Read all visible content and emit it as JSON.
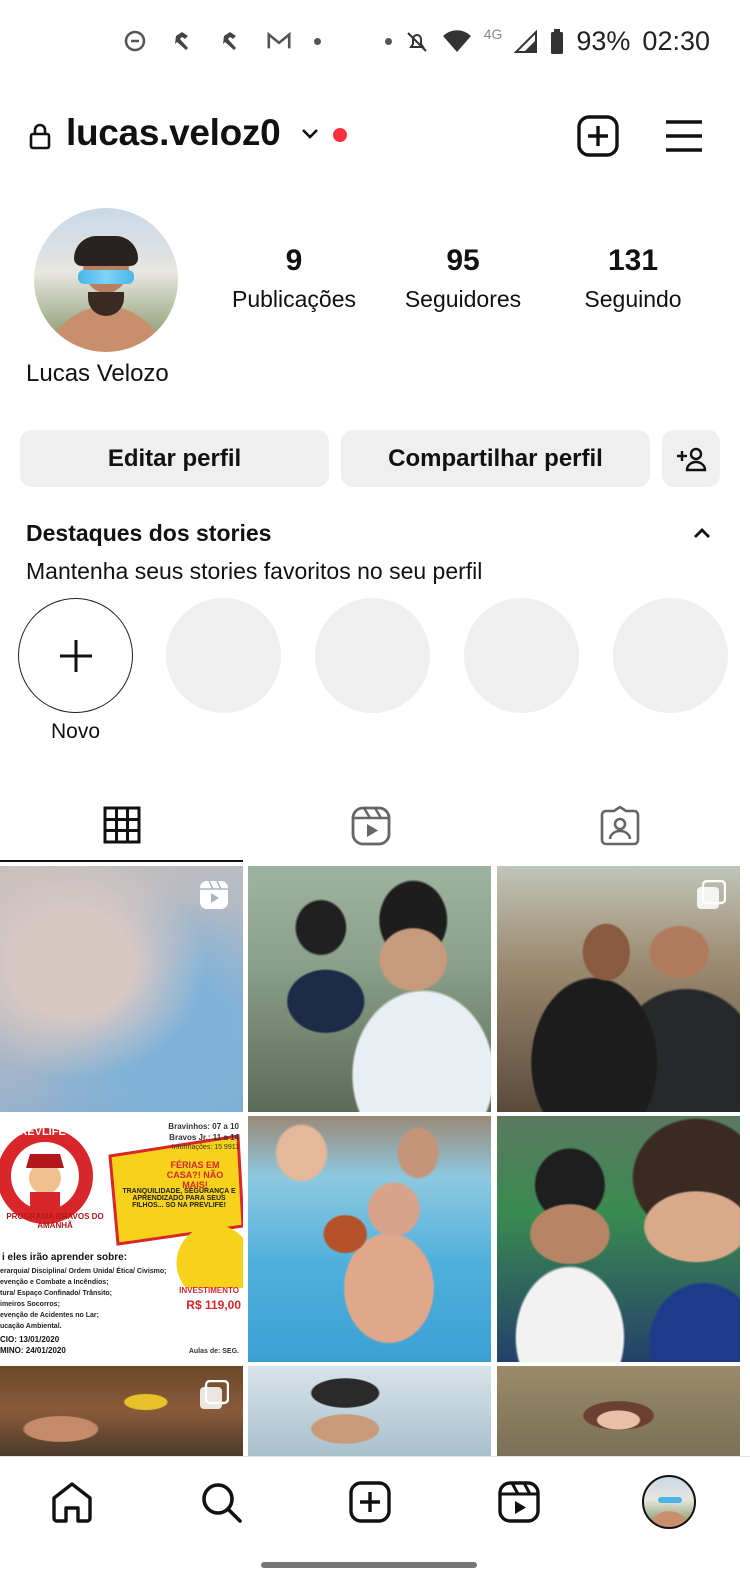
{
  "status_bar": {
    "left_icons": [
      "gmail-icon",
      "hammer-icon",
      "hammer-icon",
      "gmail-m-icon",
      "dot-icon"
    ],
    "network": "4G",
    "battery": "93%",
    "time": "02:30"
  },
  "header": {
    "username": "lucas.veloz0"
  },
  "profile": {
    "full_name": "Lucas Velozo",
    "stats": [
      {
        "value": "9",
        "label": "Publicações"
      },
      {
        "value": "95",
        "label": "Seguidores"
      },
      {
        "value": "131",
        "label": "Seguindo"
      }
    ]
  },
  "actions": {
    "edit_label": "Editar perfil",
    "share_label": "Compartilhar perfil"
  },
  "highlights": {
    "title": "Destaques dos stories",
    "subtitle": "Mantenha seus stories favoritos no seu perfil",
    "new_label": "Novo"
  },
  "tabs": [
    "grid-icon",
    "reels-icon",
    "tagged-icon"
  ],
  "grid": {
    "posts": [
      {
        "kind": "reel",
        "desc": "blurred"
      },
      {
        "kind": "photo",
        "desc": "selfie motorcycle"
      },
      {
        "kind": "carousel",
        "desc": "couple selfie"
      },
      {
        "kind": "photo",
        "desc": "flyer"
      },
      {
        "kind": "photo",
        "desc": "pool"
      },
      {
        "kind": "photo",
        "desc": "selfie with child"
      },
      {
        "kind": "carousel",
        "desc": "portrait"
      },
      {
        "kind": "photo",
        "desc": "selfie"
      },
      {
        "kind": "photo",
        "desc": "child"
      }
    ],
    "flyer": {
      "brand": "PREVLIFE",
      "program": "PROGRAMA BRAVOS DO AMANHÃ",
      "schedule1": "Bravinhos: 07 a 10",
      "schedule2": "Bravos Jr.: 11 a 14",
      "info": "Informações: 15 9911",
      "headline": "FÉRIAS EM CASA?! NÃO MAIS!",
      "tagline": "TRANQUILIDADE, SEGURANÇA E APRENDIZADO PARA SEUS FILHOS... SÓ NA PREVLIFE!",
      "learn_title": "i eles irão aprender sobre:",
      "learn_1": "erarquia/ Disciplina/ Ordem Unida/ Ética/ Civismo;",
      "learn_2": "evenção e Combate a Incêndios;",
      "learn_3": "tura/ Espaço Confinado/ Trânsito;",
      "learn_4": "imeiros Socorros;",
      "learn_5": "evenção de Acidentes no Lar;",
      "learn_6": "ucação Ambiental.",
      "price_label": "INVESTIMENTO",
      "price": "R$ 119,00",
      "start": "CIO: 13/01/2020",
      "end": "MINO: 24/01/2020",
      "classes": "Aulas de: SEG."
    }
  },
  "bottom_nav": [
    "home-icon",
    "search-icon",
    "create-icon",
    "reels-icon",
    "profile-avatar"
  ],
  "colors": {
    "accent_red": "#ff3040",
    "button_bg": "#efefef",
    "text": "#111111"
  }
}
